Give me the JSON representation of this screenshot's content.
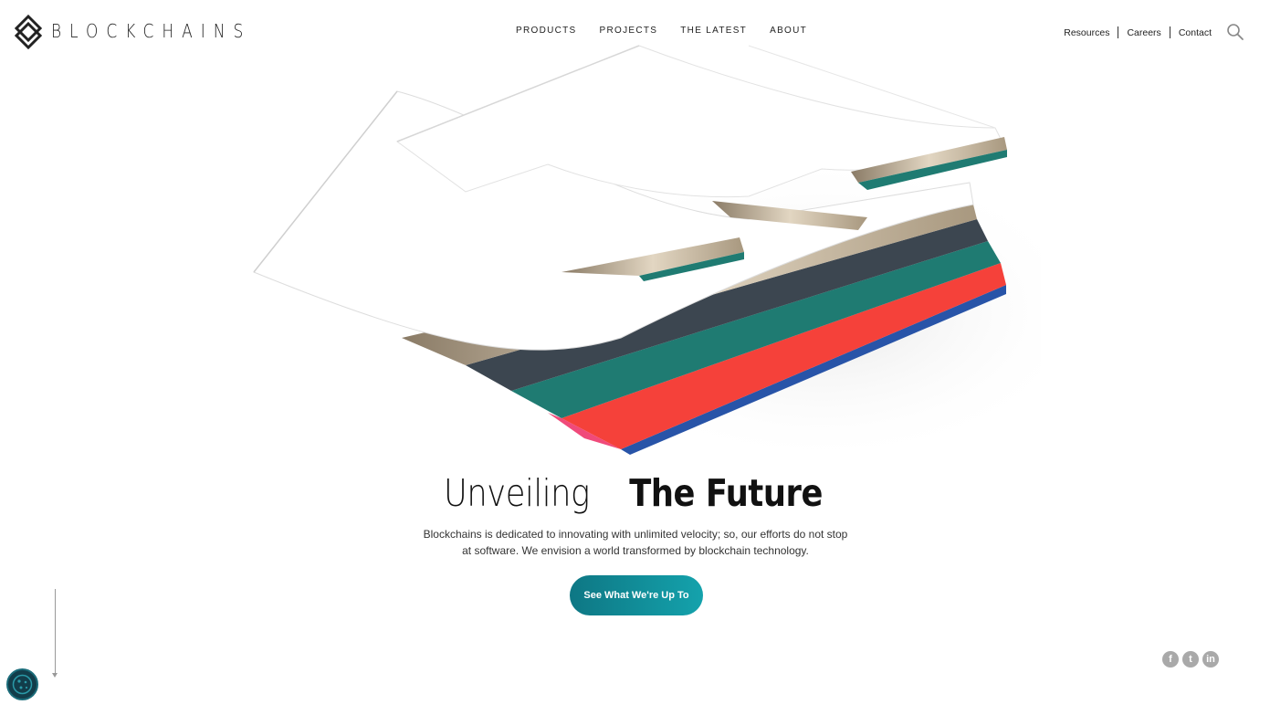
{
  "brand": {
    "name": "BLOCKCHAINS"
  },
  "nav": {
    "main": [
      "PRODUCTS",
      "PROJECTS",
      "THE LATEST",
      "ABOUT"
    ],
    "utility": [
      "Resources",
      "Careers",
      "Contact"
    ]
  },
  "hero": {
    "headline_light": "Unveiling",
    "headline_bold": "The Future",
    "description": "Blockchains is dedicated to innovating with unlimited velocity; so, our efforts do not stop at software. We envision a world transformed by blockchain technology.",
    "cta_label": "See What We're Up To"
  },
  "social": [
    "f",
    "t",
    "in"
  ],
  "icons": {
    "search": "search-icon",
    "cookie": "cookie-icon",
    "scroll": "scroll-down-arrow-icon",
    "facebook": "facebook-icon",
    "twitter": "twitter-icon",
    "linkedin": "linkedin-icon"
  },
  "colors": {
    "accent_start": "#0e7784",
    "accent_end": "#14a2ac",
    "layer_wood": "#c6b59a",
    "layer_slate": "#3c4650",
    "layer_teal": "#1f7b72",
    "layer_red": "#f5413a",
    "layer_blue": "#2854a8"
  }
}
